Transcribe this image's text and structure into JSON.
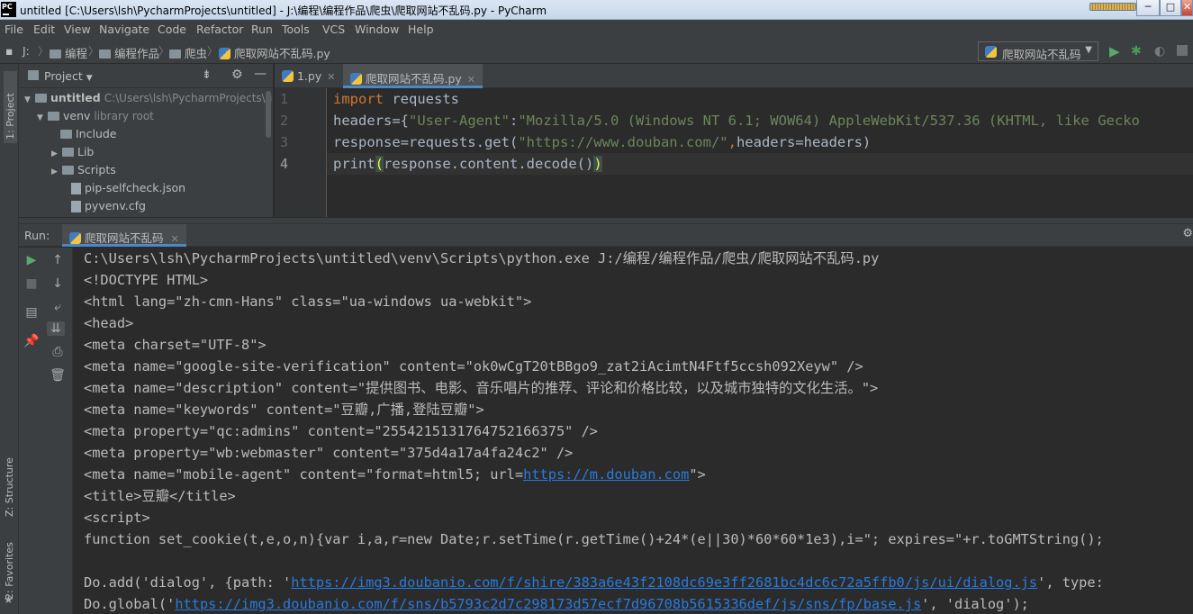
{
  "window": {
    "title": "untitled [C:\\Users\\lsh\\PycharmProjects\\untitled] - J:\\编程\\编程作品\\爬虫\\爬取网站不乱码.py - PyCharm",
    "app_icon_text": "PC",
    "minimize": "─",
    "maximize": "□",
    "close": "✕"
  },
  "menu": [
    "File",
    "Edit",
    "View",
    "Navigate",
    "Code",
    "Refactor",
    "Run",
    "Tools",
    "VCS",
    "Window",
    "Help"
  ],
  "breadcrumb": [
    "J:",
    "编程",
    "编程作品",
    "爬虫",
    "爬取网站不乱码.py"
  ],
  "run_config": {
    "label": "爬取网站不乱码"
  },
  "left_tabs": {
    "project": "1: Project",
    "structure": "Z: Structure",
    "favorites": "2: Favorites"
  },
  "project": {
    "header": "Project",
    "tree": [
      {
        "label": "untitled",
        "path": "C:\\Users\\lsh\\PycharmProjects\\un"
      },
      {
        "label": "venv",
        "note": "library root"
      },
      {
        "label": "Include"
      },
      {
        "label": "Lib"
      },
      {
        "label": "Scripts"
      },
      {
        "label": "pip-selfcheck.json"
      },
      {
        "label": "pyvenv.cfg"
      }
    ]
  },
  "editor": {
    "tabs": [
      {
        "label": "1.py",
        "active": false
      },
      {
        "label": "爬取网站不乱码.py",
        "active": true
      }
    ],
    "line_numbers": [
      "1",
      "2",
      "3",
      "4"
    ],
    "lines": [
      {
        "kw": "import",
        "rest": " requests"
      },
      {
        "pre": "headers={",
        "s1": "\"User-Agent\"",
        "mid": ":",
        "s2": "\"Mozilla/5.0 (Windows NT 6.1; WOW64) AppleWebKit/537.36 (KHTML, like Gecko"
      },
      {
        "pre": "response=requests.get(",
        "s1": "\"https://www.douban.com/\"",
        "comma": ",",
        "rest": "headers=headers)"
      },
      {
        "pre": "print",
        "p1": "(",
        "mid": "response.content.decode()",
        "p2": ")"
      }
    ]
  },
  "run": {
    "label": "Run:",
    "tab": "爬取网站不乱码",
    "console": [
      "C:\\Users\\lsh\\PycharmProjects\\untitled\\venv\\Scripts\\python.exe J:/编程/编程作品/爬虫/爬取网站不乱码.py",
      "<!DOCTYPE HTML>",
      "<html lang=\"zh-cmn-Hans\" class=\"ua-windows ua-webkit\">",
      "<head>",
      "<meta charset=\"UTF-8\">",
      "<meta name=\"google-site-verification\" content=\"ok0wCgT20tBBgo9_zat2iAcimtN4Ftf5ccsh092Xeyw\" />",
      "<meta name=\"description\" content=\"提供图书、电影、音乐唱片的推荐、评论和价格比较，以及城市独特的文化生活。\">",
      "<meta name=\"keywords\" content=\"豆瓣,广播,登陆豆瓣\">",
      "<meta property=\"qc:admins\" content=\"2554215131764752166375\" />",
      "<meta property=\"wb:webmaster\" content=\"375d4a17a4fa24c2\" />",
      "<title>豆瓣</title>",
      "<script>",
      "function set_cookie(t,e,o,n){var i,a,r=new Date;r.setTime(r.getTime()+24*(e||30)*60*60*1e3),i=\"; expires=\"+r.toGMTString();",
      ""
    ],
    "mobile_line": {
      "pre": "<meta name=\"mobile-agent\" content=\"format=html5; url=",
      "link": "https://m.douban.com",
      "post": "\">"
    },
    "doadd_line": {
      "pre": "Do.add('dialog', {path: '",
      "link": "https://img3.doubanio.com/f/shire/383a6e43f2108dc69e3ff2681bc4dc6c72a5ffb0/js/ui/dialog.js",
      "post": "', type:"
    },
    "doglobal_line": {
      "pre": "Do.global('",
      "link": "https://img3.doubanio.com/f/sns/b5793c2d7c298173d57ecf7d96708b5615336def/js/sns/fp/base.js",
      "post": "', 'dialog');"
    }
  }
}
